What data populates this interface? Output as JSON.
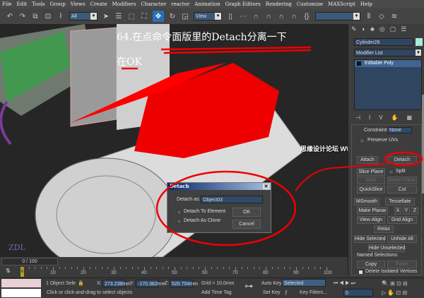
{
  "menu": [
    "File",
    "Edit",
    "Tools",
    "Group",
    "Views",
    "Create",
    "Modifiers",
    "Character",
    "reactor",
    "Animation",
    "Graph Editors",
    "Rendering",
    "Customize",
    "MAXScript",
    "Help"
  ],
  "toolbar": {
    "selection_filter": "All",
    "ref_coord": "View",
    "named_selection": ""
  },
  "annotation": {
    "line1": "64.在点命令面版里的Detach分离一下",
    "line2": "在OK",
    "watermark": "思缘设计论坛 WWW.MISSYUAN.COM",
    "logo": "ZDL"
  },
  "panel": {
    "object_name": "Cylinder26",
    "object_color": "#a8e8e0",
    "modifier_list": "Modifier List",
    "stack_item": "Editable Poly",
    "constraints_label": "Constraints:",
    "constraints_value": "None",
    "preserve_uvs": "Preserve UVs",
    "attach": "Attach",
    "detach": "Detach",
    "slice_plane": "Slice Plane",
    "split": "Split",
    "slice": "Slice",
    "reset_plane": "Reset Plane",
    "quickslice": "QuickSlice",
    "cut": "Cut",
    "msmooth": "MSmooth",
    "tessellate": "Tessellate",
    "make_planar": "Make Planar",
    "x": "X",
    "y": "Y",
    "z": "Z",
    "view_align": "View Align",
    "grid_align": "Grid Align",
    "relax": "Relax",
    "hide_selected": "Hide Selected",
    "unhide_all": "Unhide All",
    "hide_unselected": "Hide Unselected",
    "named_selections": "Named Selections:",
    "copy": "Copy",
    "paste": "Paste",
    "delete_isolated": "Delete Isolated Vertices"
  },
  "dialog": {
    "title": "Detach",
    "detach_as_label": "Detach as:",
    "detach_as_value": "Object03",
    "to_element": "Detach To Element",
    "as_clone": "Detach As Clone",
    "ok": "OK",
    "cancel": "Cancel"
  },
  "timeline": {
    "slider": "0 / 100",
    "current_frame": "0",
    "ticks": [
      "10",
      "20",
      "30",
      "40",
      "50",
      "60",
      "70",
      "80",
      "90",
      "100"
    ]
  },
  "status": {
    "selection": "1 Object Sele",
    "x_label": "X:",
    "x": "273.238mm",
    "y_label": "Y:",
    "y": "-170.382mm",
    "z_label": "Z:",
    "z": "520.704mm",
    "grid": "Grid = 10.0mm",
    "prompt": "Click or click-and-drag to select objects",
    "add_time_tag": "Add Time Tag",
    "auto_key": "Auto Key",
    "set_key": "Set Key",
    "key_mode": "Selected",
    "key_filters": "Key Filters...",
    "frame": "0"
  }
}
